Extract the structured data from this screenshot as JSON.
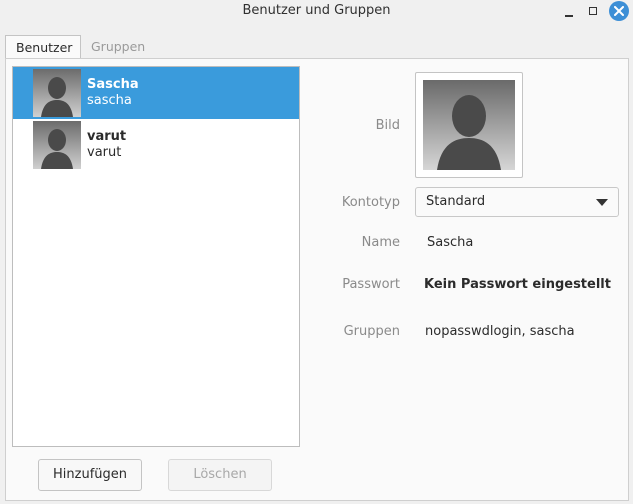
{
  "window": {
    "title": "Benutzer und Gruppen"
  },
  "tabs": [
    {
      "label": "Benutzer",
      "active": true
    },
    {
      "label": "Gruppen",
      "active": false
    }
  ],
  "users": [
    {
      "name": "Sascha",
      "login": "sascha",
      "selected": true
    },
    {
      "name": "varut",
      "login": "varut",
      "selected": false
    }
  ],
  "buttons": {
    "add_label": "Hinzufügen",
    "delete_label": "Löschen"
  },
  "details": {
    "picture_label": "Bild",
    "account_type_label": "Kontotyp",
    "account_type_value": "Standard",
    "name_label": "Name",
    "name_value": "Sascha",
    "password_label": "Passwort",
    "password_value": "Kein Passwort eingestellt",
    "groups_label": "Gruppen",
    "groups_value": "nopasswdlogin, sascha"
  },
  "colors": {
    "selection": "#3a9bdc",
    "close_button": "#3d8fd6"
  }
}
